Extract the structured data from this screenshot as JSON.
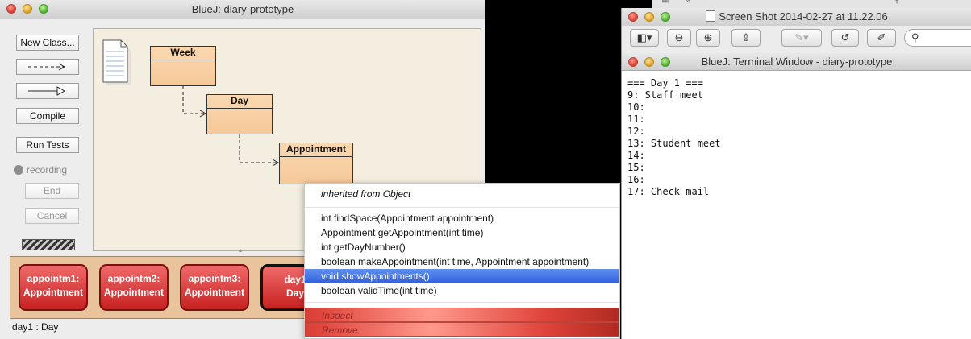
{
  "bluej": {
    "title": "BlueJ:  diary-prototype",
    "buttons": {
      "new_class": "New Class...",
      "compile": "Compile",
      "run_tests": "Run Tests",
      "recording": "recording",
      "end": "End",
      "cancel": "Cancel"
    },
    "classes": [
      "Week",
      "Day",
      "Appointment"
    ],
    "objects": [
      {
        "name": "appointm1:",
        "type": "Appointment"
      },
      {
        "name": "appointm2:",
        "type": "Appointment"
      },
      {
        "name": "appointm3:",
        "type": "Appointment"
      },
      {
        "name": "day1",
        "type": "Day"
      }
    ],
    "status": "day1 : Day"
  },
  "menu": {
    "header": "inherited from Object",
    "methods": [
      "int findSpace(Appointment appointment)",
      "Appointment getAppointment(int time)",
      "int getDayNumber()",
      "boolean makeAppointment(int time, Appointment appointment)",
      "void showAppointments()",
      "boolean validTime(int time)"
    ],
    "selected_index": 4,
    "inspect": "Inspect",
    "remove": "Remove"
  },
  "preview": {
    "title": "Screen Shot 2014-02-27 at 11.22.06"
  },
  "terminal": {
    "title": "BlueJ: Terminal Window - diary-prototype",
    "lines": [
      "=== Day 1 ===",
      "9: Staff meet",
      "10:",
      "11:",
      "12:",
      "13: Student meet",
      "14:",
      "15:",
      "16:",
      "17: Check mail"
    ]
  },
  "colors": {
    "menu_highlight": "#3d6fe4",
    "object_red": "#d32f2f",
    "class_fill": "#f5c999"
  }
}
